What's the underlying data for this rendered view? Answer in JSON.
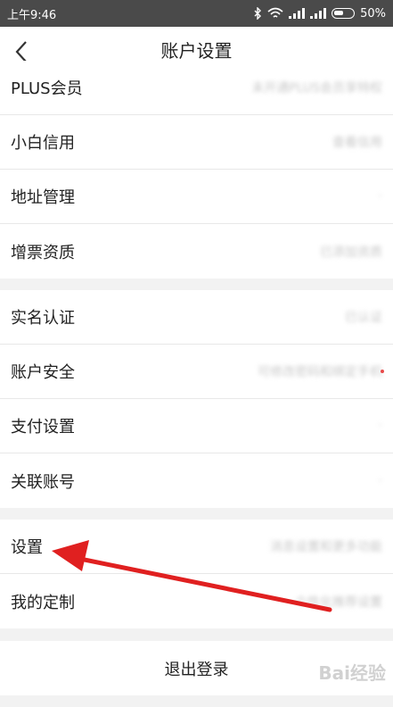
{
  "status_bar": {
    "time": "上午9:46",
    "battery": "50%"
  },
  "header": {
    "title": "账户设置"
  },
  "groups": [
    {
      "items": [
        {
          "label": "PLUS会员",
          "value": "未开通PLUS会员享特权"
        },
        {
          "label": "小白信用",
          "value": "查看信用"
        },
        {
          "label": "地址管理",
          "value": "·"
        },
        {
          "label": "增票资质",
          "value": "已添加资质"
        }
      ]
    },
    {
      "items": [
        {
          "label": "实名认证",
          "value": "已认证"
        },
        {
          "label": "账户安全",
          "value": "可修改密码和绑定手机"
        },
        {
          "label": "支付设置",
          "value": "·"
        },
        {
          "label": "关联账号",
          "value": "·"
        }
      ]
    },
    {
      "items": [
        {
          "label": "设置",
          "value": "消息设置和更多功能"
        },
        {
          "label": "我的定制",
          "value": "个性化推荐设置"
        }
      ]
    }
  ],
  "logout_label": "退出登录",
  "watermark": "Bai经验",
  "colors": {
    "arrow": "#e02020",
    "status_bar": "#4a4a4a",
    "background": "#f2f2f2"
  }
}
